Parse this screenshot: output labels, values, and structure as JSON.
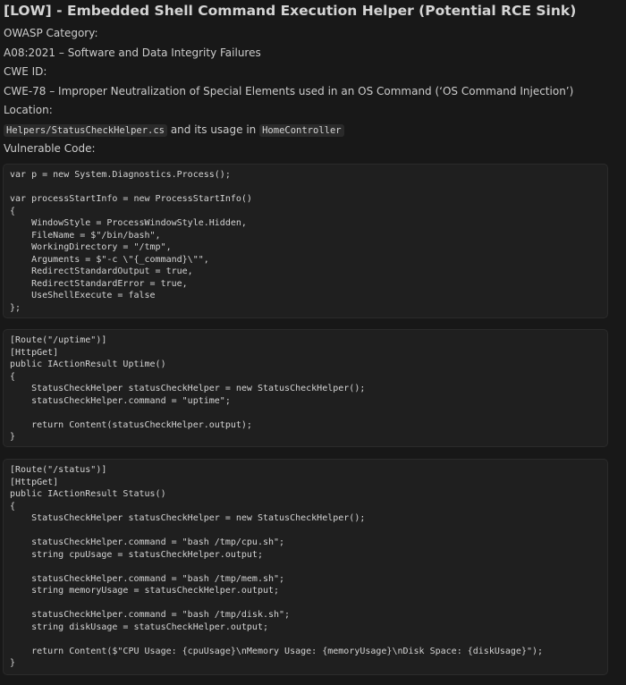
{
  "title": "[LOW] - Embedded Shell Command Execution Helper (Potential RCE Sink)",
  "owasp_label": "OWASP Category:",
  "owasp_value": "A08:2021 – Software and Data Integrity Failures",
  "cwe_label": "CWE ID:",
  "cwe_value": "CWE-78 – Improper Neutralization of Special Elements used in an OS Command (‘OS Command Injection’)",
  "location_label": "Location:",
  "location": {
    "file": "Helpers/StatusCheckHelper.cs",
    "middle": " and its usage in ",
    "controller": "HomeController"
  },
  "vulnerable_label": "Vulnerable Code:",
  "code_blocks": [
    "var p = new System.Diagnostics.Process();\n\nvar processStartInfo = new ProcessStartInfo()\n{\n    WindowStyle = ProcessWindowStyle.Hidden,\n    FileName = $\"/bin/bash\",\n    WorkingDirectory = \"/tmp\",\n    Arguments = $\"-c \\\"{_command}\\\"\",\n    RedirectStandardOutput = true,\n    RedirectStandardError = true,\n    UseShellExecute = false\n};",
    "[Route(\"/uptime\")]\n[HttpGet]\npublic IActionResult Uptime()\n{\n    StatusCheckHelper statusCheckHelper = new StatusCheckHelper();\n    statusCheckHelper.command = \"uptime\";\n\n    return Content(statusCheckHelper.output);\n}",
    "[Route(\"/status\")]\n[HttpGet]\npublic IActionResult Status()\n{\n    StatusCheckHelper statusCheckHelper = new StatusCheckHelper();\n\n    statusCheckHelper.command = \"bash /tmp/cpu.sh\";\n    string cpuUsage = statusCheckHelper.output;\n\n    statusCheckHelper.command = \"bash /tmp/mem.sh\";\n    string memoryUsage = statusCheckHelper.output;\n\n    statusCheckHelper.command = \"bash /tmp/disk.sh\";\n    string diskUsage = statusCheckHelper.output;\n\n    return Content($\"CPU Usage: {cpuUsage}\\nMemory Usage: {memoryUsage}\\nDisk Space: {diskUsage}\");\n}"
  ]
}
